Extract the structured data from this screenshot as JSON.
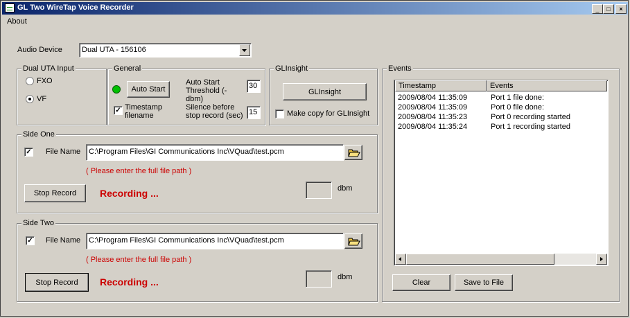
{
  "window": {
    "title": "GL Two WireTap Voice Recorder",
    "controls": [
      "_",
      "□",
      "×"
    ]
  },
  "menu": {
    "items": [
      "About"
    ]
  },
  "audio_device": {
    "label": "Audio Device",
    "value": "Dual UTA - 156106"
  },
  "dual_uta": {
    "title": "Dual UTA Input",
    "options": [
      "FXO",
      "VF"
    ],
    "selected": "VF"
  },
  "general": {
    "title": "General",
    "auto_start_label": "Auto Start",
    "status_color": "#00c000",
    "timestamp_label": "Timestamp filename",
    "timestamp_checked": true,
    "threshold_label": "Auto Start Threshold (-dbm)",
    "threshold_value": "30",
    "silence_label": "Silence before stop record (sec)",
    "silence_value": "15"
  },
  "glinsight": {
    "title": "GLInsight",
    "button_label": "GLInsight",
    "copy_label": "Make copy for GLInsight",
    "copy_checked": false
  },
  "side_one": {
    "title": "Side One",
    "file_label": "File Name",
    "file_checked": true,
    "file_path": "C:\\Program Files\\GI Communications Inc\\VQuad\\test.pcm",
    "hint": "( Please enter the full file path )",
    "stop_label": "Stop Record",
    "status": "Recording ...",
    "dbm_value": "",
    "dbm_label": "dbm"
  },
  "side_two": {
    "title": "Side Two",
    "file_label": "File Name",
    "file_checked": true,
    "file_path": "C:\\Program Files\\GI Communications Inc\\VQuad\\test.pcm",
    "hint": "( Please enter the full file path )",
    "stop_label": "Stop Record",
    "status": "Recording ...",
    "dbm_value": "",
    "dbm_label": "dbm"
  },
  "events": {
    "title": "Events",
    "columns": [
      "Timestamp",
      "Events"
    ],
    "rows": [
      [
        "2009/08/04 11:35:09",
        "Port 1 file done:"
      ],
      [
        "2009/08/04 11:35:09",
        "Port 0 file done:"
      ],
      [
        "2009/08/04 11:35:23",
        "Port 0 recording started"
      ],
      [
        "2009/08/04 11:35:24",
        "Port 1 recording started"
      ]
    ],
    "clear_label": "Clear",
    "save_label": "Save to File"
  }
}
